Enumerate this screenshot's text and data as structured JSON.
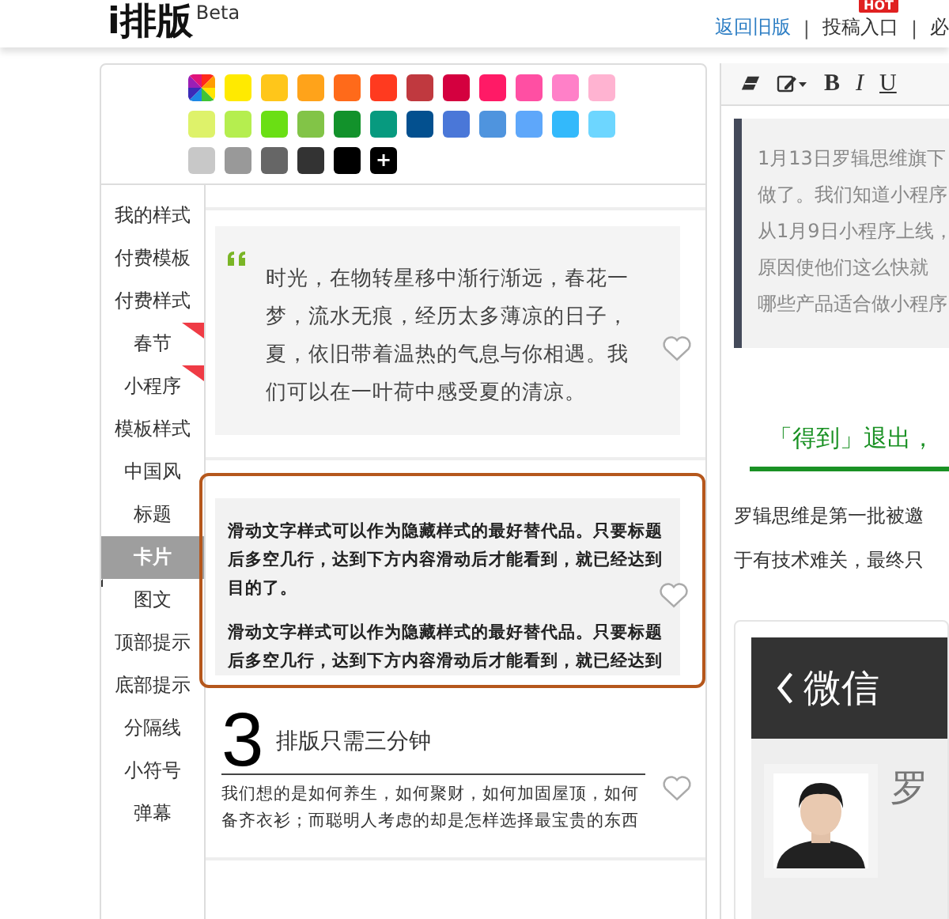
{
  "header": {
    "logo": "i排版",
    "logo_sup": "Beta",
    "links": [
      {
        "label": "返回旧版",
        "kind": "primary"
      },
      {
        "label": "投稿入口",
        "kind": "plain",
        "badge": "HOT"
      },
      {
        "label": "必",
        "kind": "plain"
      }
    ],
    "separator": "|"
  },
  "palette": [
    [
      {
        "kind": "rainbow"
      },
      {
        "kind": "swatch",
        "color": "#ffea00"
      },
      {
        "kind": "swatch",
        "color": "#ffc61a"
      },
      {
        "kind": "swatch",
        "color": "#ffa31a"
      },
      {
        "kind": "swatch",
        "color": "#ff6a1a"
      },
      {
        "kind": "swatch",
        "color": "#ff3a1f"
      },
      {
        "kind": "swatch",
        "color": "#c0393f"
      },
      {
        "kind": "swatch",
        "color": "#d4003f"
      },
      {
        "kind": "swatch",
        "color": "#ff1a66"
      },
      {
        "kind": "swatch",
        "color": "#ff4fa3"
      },
      {
        "kind": "swatch",
        "color": "#ff80c8"
      },
      {
        "kind": "swatch",
        "color": "#ffb3d1"
      }
    ],
    [
      {
        "kind": "swatch",
        "color": "#def26a"
      },
      {
        "kind": "swatch",
        "color": "#b5ee4f"
      },
      {
        "kind": "swatch",
        "color": "#6adf14"
      },
      {
        "kind": "swatch",
        "color": "#82c447"
      },
      {
        "kind": "swatch",
        "color": "#12922b"
      },
      {
        "kind": "swatch",
        "color": "#079a7f"
      },
      {
        "kind": "swatch",
        "color": "#03508f"
      },
      {
        "kind": "swatch",
        "color": "#4a77d8"
      },
      {
        "kind": "swatch",
        "color": "#4f94de"
      },
      {
        "kind": "swatch",
        "color": "#5ea7fa"
      },
      {
        "kind": "swatch",
        "color": "#33b9fb"
      },
      {
        "kind": "swatch",
        "color": "#6dd6ff"
      }
    ],
    [
      {
        "kind": "swatch",
        "color": "#c8c8c8"
      },
      {
        "kind": "swatch",
        "color": "#999999"
      },
      {
        "kind": "swatch",
        "color": "#666666"
      },
      {
        "kind": "swatch",
        "color": "#333333"
      },
      {
        "kind": "swatch",
        "color": "#000000"
      },
      {
        "kind": "add",
        "label": "+"
      }
    ]
  ],
  "sidebar": {
    "items": [
      {
        "label": "我的样式",
        "selected": false,
        "flagged": false
      },
      {
        "label": "付费模板",
        "selected": false,
        "flagged": false
      },
      {
        "label": "付费样式",
        "selected": false,
        "flagged": false
      },
      {
        "label": "春节",
        "selected": false,
        "flagged": true
      },
      {
        "label": "小程序",
        "selected": false,
        "flagged": true
      },
      {
        "label": "模板样式",
        "selected": false,
        "flagged": false
      },
      {
        "label": "中国风",
        "selected": false,
        "flagged": false
      },
      {
        "label": "标题",
        "selected": false,
        "flagged": false
      },
      {
        "label": "卡片",
        "selected": true,
        "flagged": false
      },
      {
        "label": "图文",
        "selected": false,
        "flagged": false
      },
      {
        "label": "顶部提示",
        "selected": false,
        "flagged": false
      },
      {
        "label": "底部提示",
        "selected": false,
        "flagged": false
      },
      {
        "label": "分隔线",
        "selected": false,
        "flagged": false
      },
      {
        "label": "小符号",
        "selected": false,
        "flagged": false
      },
      {
        "label": "弹幕",
        "selected": false,
        "flagged": false
      }
    ]
  },
  "cards": [
    {
      "kind": "quote",
      "selected": false,
      "text": "时光，在物转星移中渐行渐远，春花一梦，流水无痕，经历太多薄凉的日子，夏，依旧带着温热的气息与你相遇。我们可以在一叶荷中感受夏的清凉。"
    },
    {
      "kind": "text",
      "selected": true,
      "paragraphs": [
        "滑动文字样式可以作为隐藏样式的最好替代品。只要标题后多空几行，达到下方内容滑动后才能看到，就已经达到目的了。",
        "滑动文字样式可以作为隐藏样式的最好替代品。只要标题后多空几行，达到下方内容滑动后才能看到，就已经达到"
      ]
    },
    {
      "kind": "numbered",
      "selected": false,
      "number": "3",
      "title": "排版只需三分钟",
      "text": "我们想的是如何养生，如何聚财，如何加固屋顶，如何备齐衣衫；而聪明人考虑的却是怎样选择最宝贵的东西"
    }
  ],
  "editor": {
    "toolbar": [
      {
        "kind": "eraser"
      },
      {
        "kind": "edit"
      },
      {
        "kind": "text",
        "label": "B"
      },
      {
        "kind": "text",
        "label": "I"
      },
      {
        "kind": "text",
        "label": "U"
      }
    ],
    "quote_lines": [
      "1月13日罗辑思维旗下",
      "做了。我们知道小程序",
      "从1月9日小程序上线，",
      "原因使他们这么快就",
      "哪些产品适合做小程序"
    ],
    "heading": "「得到」退出，",
    "paragraph_lines": [
      "罗辑思维是第一批被邀",
      "于有技术难关，最终只"
    ],
    "phone": {
      "bar_title": "微信",
      "name": "罗"
    }
  }
}
